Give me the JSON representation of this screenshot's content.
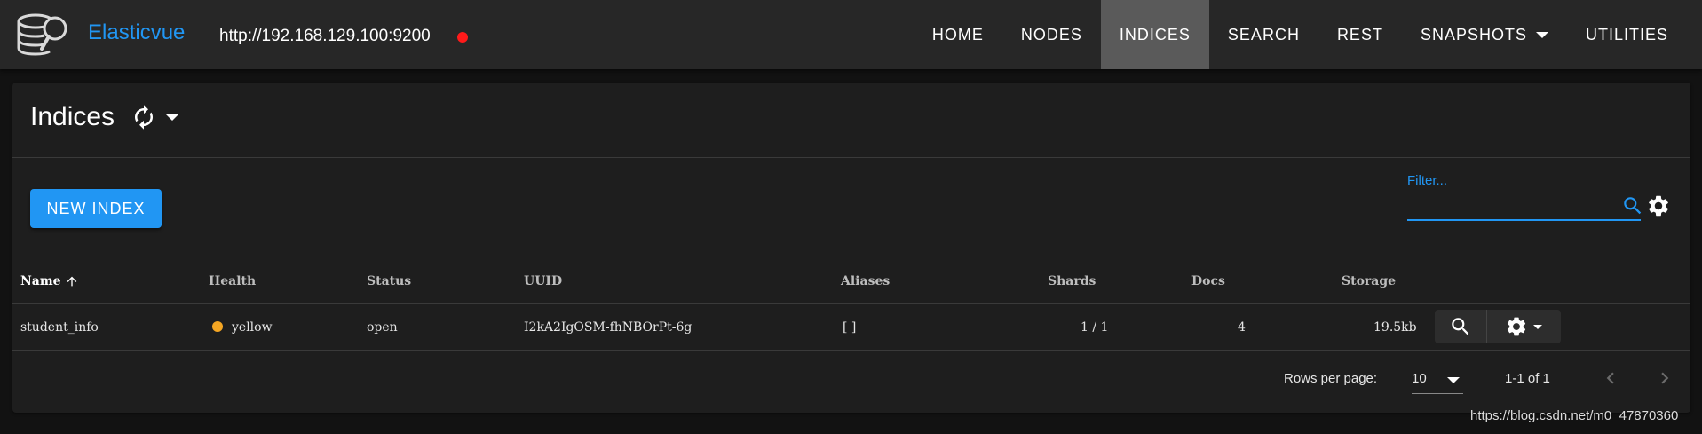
{
  "app": {
    "brand": "Elasticvue",
    "cluster_url": "http://192.168.129.100:9200",
    "status_color": "#ff1a1a",
    "accent": "#2196f3"
  },
  "nav": {
    "items": [
      {
        "label": "HOME"
      },
      {
        "label": "NODES"
      },
      {
        "label": "INDICES",
        "active": true
      },
      {
        "label": "SEARCH"
      },
      {
        "label": "REST"
      },
      {
        "label": "SNAPSHOTS",
        "dropdown": true
      },
      {
        "label": "UTILITIES"
      }
    ]
  },
  "page": {
    "title": "Indices",
    "new_index_label": "NEW INDEX",
    "filter_label": "Filter...",
    "filter_value": ""
  },
  "table": {
    "columns": [
      "Name",
      "Health",
      "Status",
      "UUID",
      "Aliases",
      "Shards",
      "Docs",
      "Storage"
    ],
    "rows": [
      {
        "name": "student_info",
        "health": "yellow",
        "health_color": "#f5a623",
        "status": "open",
        "uuid": "I2kA2IgOSM-fhNBOrPt-6g",
        "aliases": "[ ]",
        "shards": "1 / 1",
        "docs": "4",
        "storage": "19.5kb"
      }
    ]
  },
  "pagination": {
    "rows_per_page_label": "Rows per page:",
    "rows_per_page": "10",
    "range": "1-1 of 1"
  },
  "watermark": "https://blog.csdn.net/m0_47870360"
}
